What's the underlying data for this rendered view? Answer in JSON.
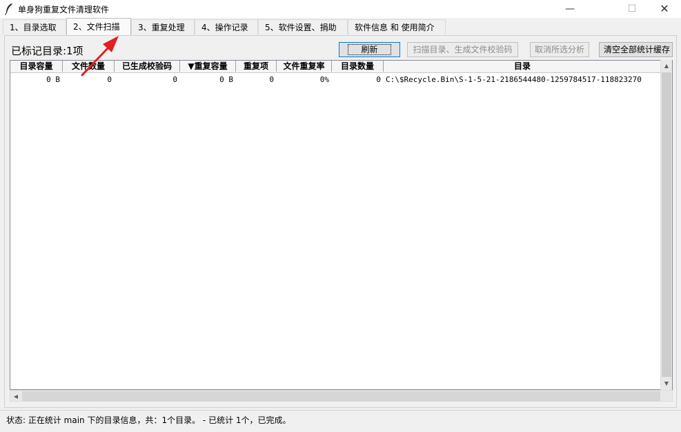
{
  "window": {
    "title": "单身狗重复文件清理软件",
    "min_glyph": "—",
    "max_glyph": "☐",
    "close_glyph": "✕"
  },
  "tabs": [
    {
      "label": "1、目录选取"
    },
    {
      "label": "2、文件扫描"
    },
    {
      "label": "3、重复处理"
    },
    {
      "label": "4、操作记录"
    },
    {
      "label": "5、软件设置、捐助"
    },
    {
      "label": "软件信息 和 使用简介"
    }
  ],
  "active_tab": 1,
  "toolbar": {
    "marked_label": "已标记目录:1项",
    "refresh": "刷新",
    "scan": "扫描目录、生成文件校验码",
    "cancel": "取消所选分析",
    "clear_cache": "清空全部统计缓存"
  },
  "table": {
    "columns": [
      "目录容量",
      "文件数量",
      "已生成校验码",
      "▼重复容量",
      "重复项",
      "文件重复率",
      "目录数量",
      "目录"
    ],
    "rows": [
      [
        "0 B",
        "0",
        "0",
        "0 B",
        "0",
        "0%",
        "0",
        "C:\\$Recycle.Bin\\S-1-5-21-2186544480-1259784517-118823270"
      ]
    ]
  },
  "status": "状态: 正在统计 main 下的目录信息，共：1个目录。 - 已统计 1个，已完成。",
  "colors": {
    "annotation_arrow": "#e02020",
    "focus_border": "#0078d7"
  }
}
